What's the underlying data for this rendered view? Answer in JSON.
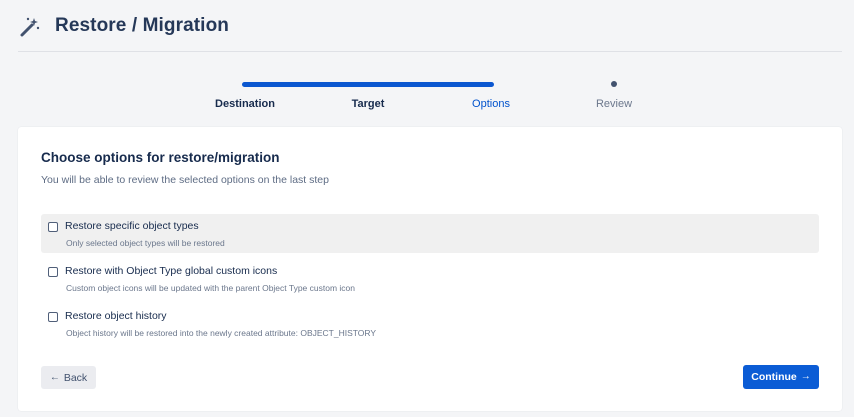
{
  "header": {
    "title": "Restore / Migration",
    "icon": "magic-wand-icon"
  },
  "stepper": {
    "steps": [
      {
        "label": "Destination",
        "state": "done"
      },
      {
        "label": "Target",
        "state": "done"
      },
      {
        "label": "Options",
        "state": "active"
      },
      {
        "label": "Review",
        "state": "todo"
      }
    ],
    "accent": "#0b57d0"
  },
  "card": {
    "title": "Choose options for restore/migration",
    "subtitle": "You will be able to review the selected options on the last step",
    "options": [
      {
        "label": "Restore specific object types",
        "description": "Only selected object types will be restored",
        "checked": false
      },
      {
        "label": "Restore with Object Type global custom icons",
        "description": "Custom object icons will be updated with the parent Object Type custom icon",
        "checked": false
      },
      {
        "label": "Restore object history",
        "description": "Object history will be restored into the newly created attribute: OBJECT_HISTORY",
        "checked": false
      }
    ]
  },
  "buttons": {
    "back": "Back",
    "continue": "Continue",
    "primary_color": "#0b5cd5"
  }
}
